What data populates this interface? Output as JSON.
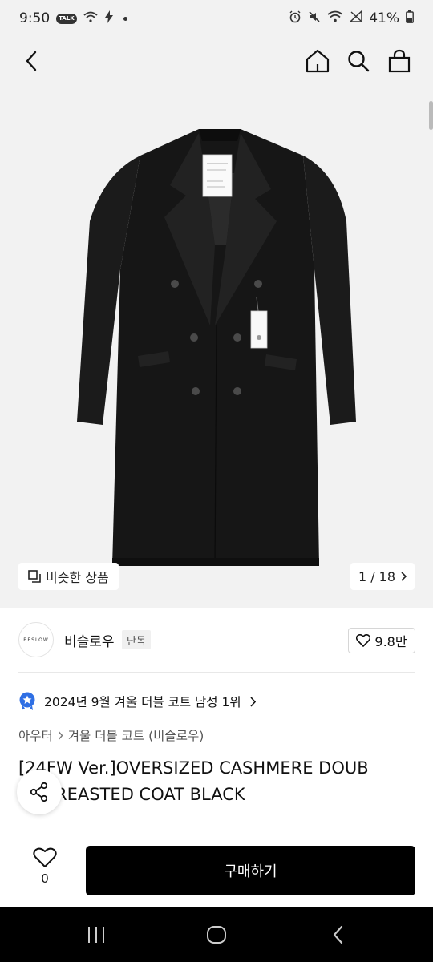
{
  "status_bar": {
    "time": "9:50",
    "talk_badge": "TALK",
    "battery": "41%"
  },
  "icons": {
    "back": "chevron-left-icon",
    "home": "home-icon",
    "search": "search-icon",
    "bag": "shopping-bag-icon",
    "heart": "heart-icon",
    "share": "share-icon",
    "similar": "similar-items-icon",
    "medal": "ranking-medal-icon"
  },
  "gallery": {
    "similar_label": "비슷한 상품",
    "page_counter": "1 / 18"
  },
  "brand": {
    "logo_text": "BESLOW",
    "name": "비슬로우",
    "badge": "단독",
    "like_count": "9.8만"
  },
  "ranking": {
    "text": "2024년 9월 겨울 더블 코트 남성 1위"
  },
  "breadcrumb": {
    "category": "아우터",
    "subcategory": "겨울 더블 코트 (비슬로우)"
  },
  "product": {
    "title_line1": "[24FW Ver.]OVERSIZED CASHMERE DOUB",
    "title_line2": "LE BREASTED COAT BLACK"
  },
  "action_bar": {
    "wish_count": "0",
    "buy_label": "구매하기"
  },
  "colors": {
    "background_gray": "#f2f2f2",
    "primary_button": "#000000",
    "ranking_medal": "#2f6fe4"
  }
}
